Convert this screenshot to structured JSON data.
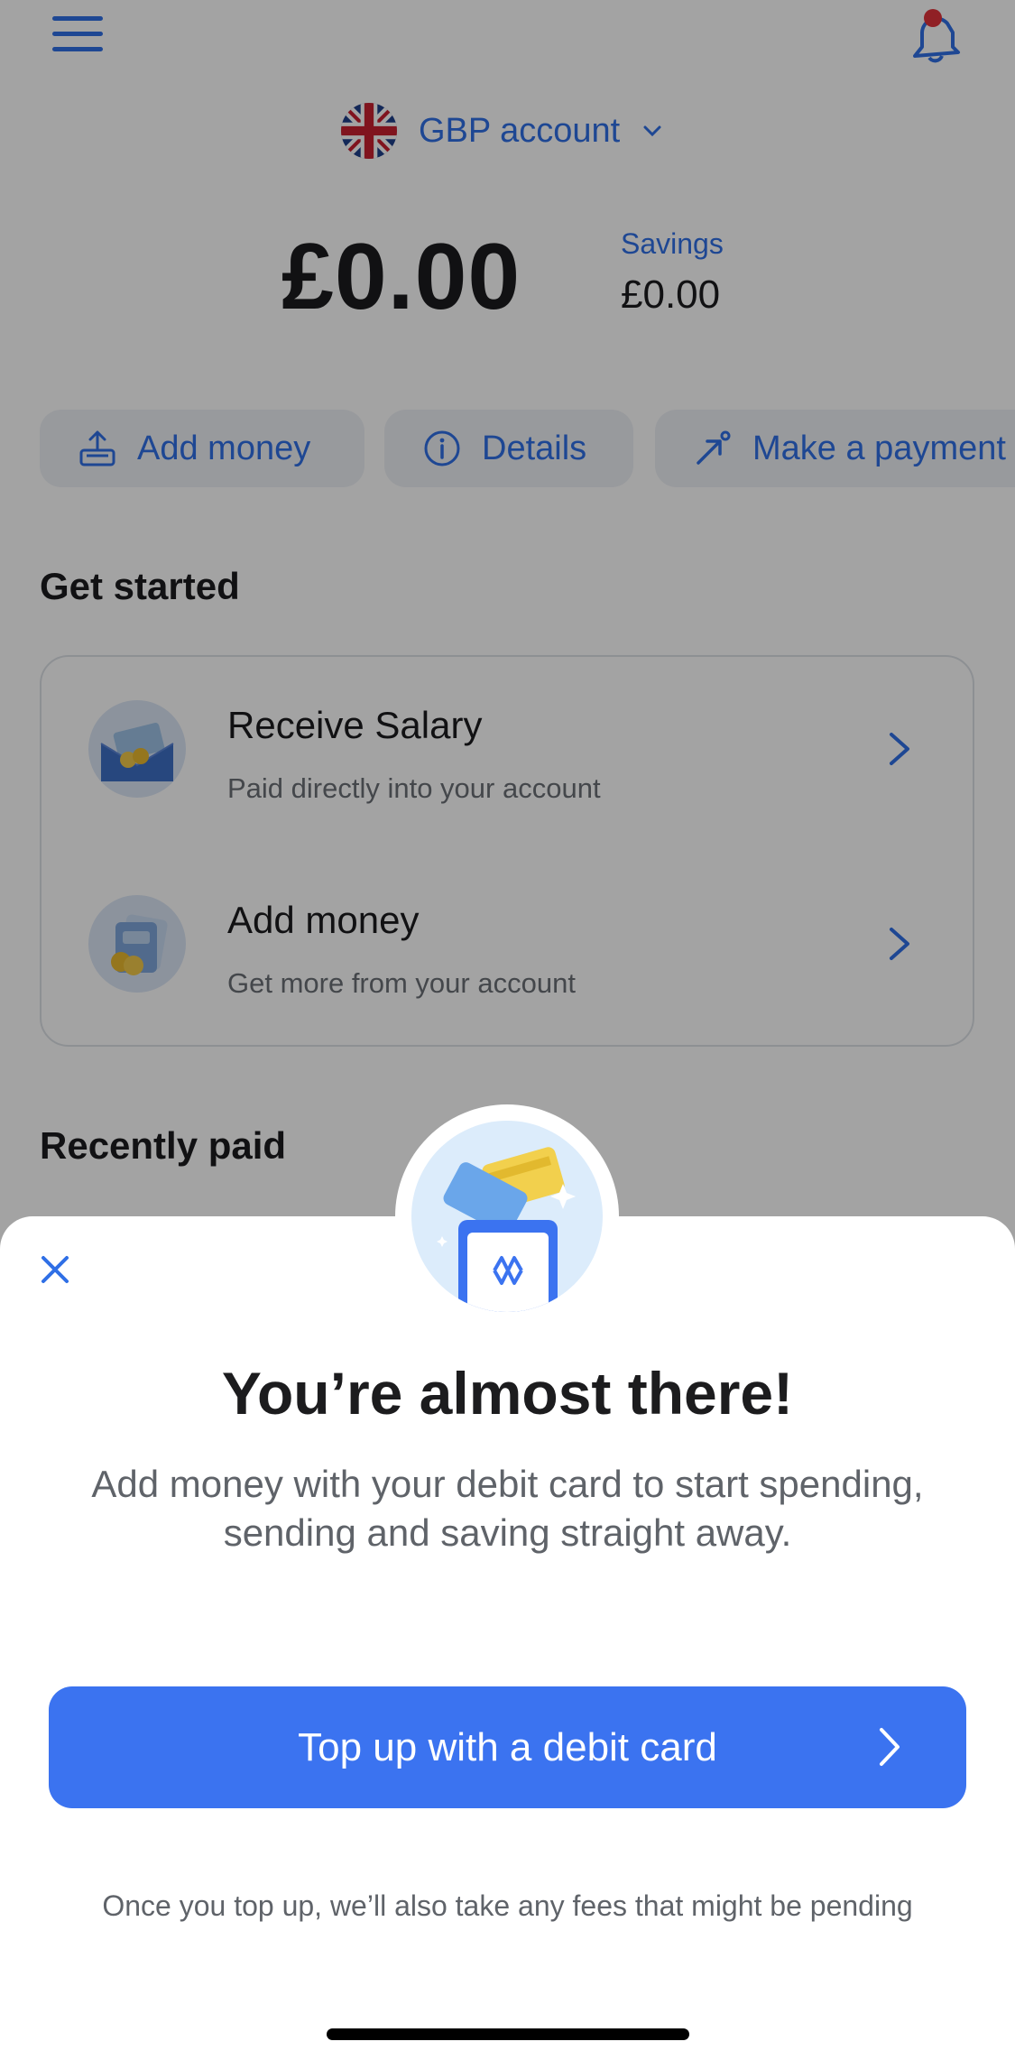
{
  "header": {
    "account_label": "GBP account",
    "menu_icon": "hamburger-menu-icon",
    "notification_icon": "bell-icon"
  },
  "balance": {
    "amount": "£0.00",
    "savings_label": "Savings",
    "savings_amount": "£0.00"
  },
  "actions": [
    {
      "label": "Add money",
      "icon": "add-money-icon"
    },
    {
      "label": "Details",
      "icon": "info-icon"
    },
    {
      "label": "Make a payment",
      "icon": "send-arrow-icon"
    }
  ],
  "get_started": {
    "title": "Get started",
    "items": [
      {
        "title": "Receive Salary",
        "subtitle": "Paid directly into your account",
        "icon": "salary-envelope-icon"
      },
      {
        "title": "Add money",
        "subtitle": "Get more from your account",
        "icon": "cards-coins-icon"
      }
    ]
  },
  "recently_paid": {
    "title": "Recently paid"
  },
  "sheet": {
    "title": "You’re almost there!",
    "body": "Add money with your debit card to start spending, sending and saving straight away.",
    "cta_label": "Top up with a debit card",
    "footnote": "Once you top up, we’ll also take any fees that might be pending"
  },
  "colors": {
    "accent": "#2f6fe6",
    "cta": "#3b73f0",
    "overlay": "rgba(0,0,0,0.36)",
    "notification_dot": "#e2323b"
  }
}
